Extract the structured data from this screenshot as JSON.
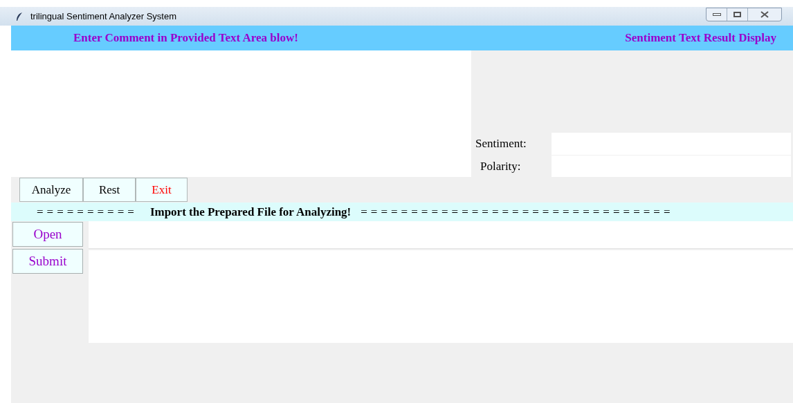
{
  "window": {
    "title": "trilingual Sentiment Analyzer System"
  },
  "header": {
    "left": "Enter Comment in Provided Text Area blow!",
    "right": "Sentiment Text Result Display"
  },
  "result_fields": [
    {
      "label": "Sentiment:"
    },
    {
      "label": "Polarity:"
    }
  ],
  "action_buttons": [
    {
      "label": "Analyze",
      "color": "#000000"
    },
    {
      "label": "Rest",
      "color": "#000000"
    },
    {
      "label": "Exit",
      "color": "#ff0000"
    }
  ],
  "import_banner": {
    "left_rule": "==========",
    "text": "Import the Prepared File for Analyzing!",
    "right_rule": "==============================="
  },
  "file_buttons": [
    {
      "label": "Open"
    },
    {
      "label": "Submit"
    }
  ]
}
